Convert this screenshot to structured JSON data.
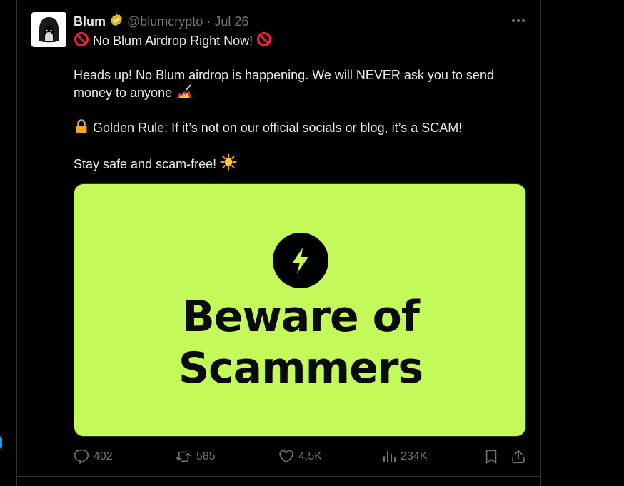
{
  "tweet": {
    "display_name": "Blum",
    "verified_badge": "gold-verified-icon",
    "handle": "@blumcrypto",
    "separator": "·",
    "date": "Jul 26",
    "line1": "No Blum Airdrop Right Now!",
    "line2": "Heads up! No Blum airdrop is happening. We will NEVER ask you to send",
    "line3": "money to anyone",
    "line4": "Golden Rule: If it’s not on our official socials or blog, it’s a SCAM!",
    "line5": "Stay safe and scam-free!"
  },
  "media": {
    "title_line1": "Beware of",
    "title_line2": "Scammers",
    "background": "#c3fa5a",
    "icon": "lightning-bolt-icon"
  },
  "actions": {
    "replies": "402",
    "reposts": "585",
    "likes": "4.5K",
    "views": "234K"
  },
  "colors": {
    "background": "#000000",
    "text": "#e7e9ea",
    "muted": "#71767b",
    "divider": "#2f3336",
    "accent_blue": "#1d9bf0"
  }
}
